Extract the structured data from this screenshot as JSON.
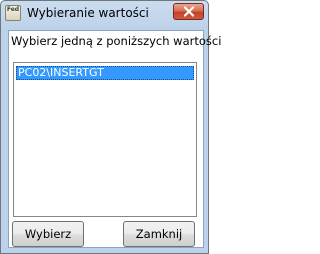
{
  "window": {
    "title": "Wybieranie wartości",
    "app_icon": "Fed",
    "close_icon": "close-x"
  },
  "dialog": {
    "prompt": "Wybierz jedną z poniższych wartości",
    "list_items": [
      "PC02\\INSERTGT"
    ],
    "selected_index": 0
  },
  "buttons": {
    "select_label": "Wybierz",
    "close_label": "Zamknij"
  },
  "colors": {
    "selection": "#3399ff",
    "window_frame": "#bcd1ea",
    "close_button": "#c4432a"
  }
}
